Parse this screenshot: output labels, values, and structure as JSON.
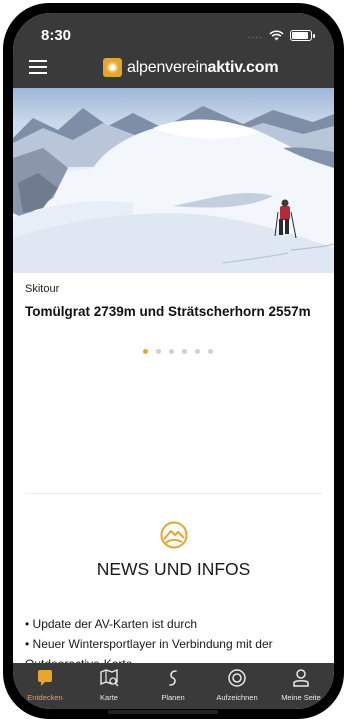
{
  "status": {
    "time": "8:30",
    "dots": "...."
  },
  "header": {
    "logo_prefix": "alpenverein",
    "logo_bold": "aktiv.com"
  },
  "card": {
    "type": "Skitour",
    "title": "Tomülgrat 2739m und Strätscherhorn 2557m"
  },
  "pager": {
    "count": 6,
    "active_index": 0
  },
  "news": {
    "title": "NEWS UND INFOS",
    "items": [
      "• Update der AV-Karten ist durch",
      "• Neuer Wintersportlayer in Verbindung mit der",
      "Outdooractive-Karte"
    ]
  },
  "tabs": [
    {
      "label": "Entdecken",
      "icon": "discover-icon",
      "active": true
    },
    {
      "label": "Karte",
      "icon": "map-icon",
      "active": false
    },
    {
      "label": "Planen",
      "icon": "route-icon",
      "active": false
    },
    {
      "label": "Aufzeichnen",
      "icon": "record-icon",
      "active": false
    },
    {
      "label": "Meine Seite",
      "icon": "profile-icon",
      "active": false
    }
  ],
  "colors": {
    "accent": "#e6a531",
    "bar": "#3a3a3a"
  }
}
